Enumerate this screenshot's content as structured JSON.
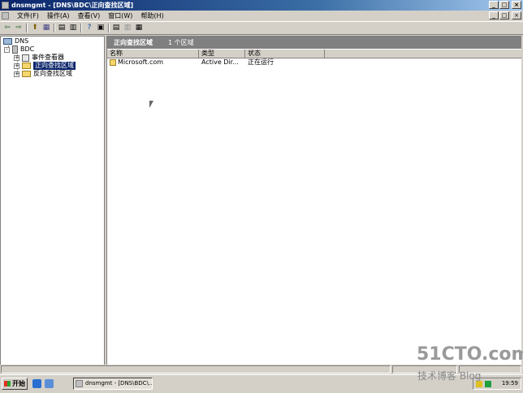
{
  "window": {
    "title": "dnsmgmt - [DNS\\BDC\\正向查找区域]"
  },
  "window_controls": {
    "minimize": "_",
    "maximize": "□",
    "close": "×"
  },
  "mdi_controls": {
    "minimize": "_",
    "restore": "□",
    "close": "×"
  },
  "menu": [
    "文件(F)",
    "操作(A)",
    "查看(V)",
    "窗口(W)",
    "帮助(H)"
  ],
  "toolbar": {
    "back": "⇦",
    "forward": "⇨",
    "up": "⬆",
    "tree": "▦",
    "properties": "▤",
    "export": "▥",
    "help": "?",
    "console": "▣",
    "b1": "▤",
    "b2": "▥",
    "b3": "▦"
  },
  "tree": {
    "root": "DNS",
    "server": "BDC",
    "children": [
      "事件查看器",
      "正向查找区域",
      "反向查找区域"
    ],
    "expanders": [
      "-",
      "+",
      "+",
      "+"
    ]
  },
  "content": {
    "header_title": "正向查找区域",
    "header_count": "1 个区域",
    "columns": [
      "名称",
      "类型",
      "状态"
    ],
    "rows": [
      {
        "name": "Microsoft.com",
        "type": "Active Dir...",
        "status": "正在运行"
      }
    ]
  },
  "taskbar": {
    "start": "开始",
    "task": "dnsmgmt - [DNS\\BDC\\...",
    "clock": "19:59"
  },
  "watermark": {
    "site": "51CTO.com",
    "blog": "技术博客 Blog"
  },
  "colors": {
    "title_start": "#0a246a",
    "title_end": "#a6caf0",
    "selection": "#0a246a",
    "face": "#d4d0c8"
  }
}
